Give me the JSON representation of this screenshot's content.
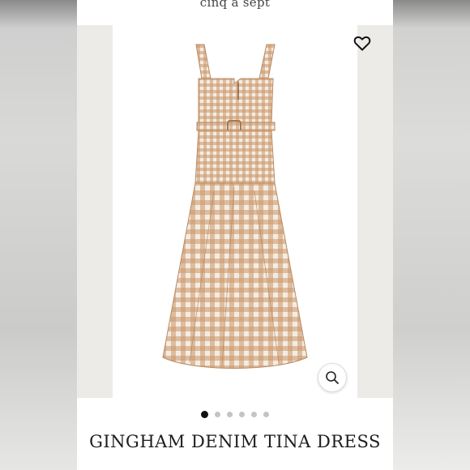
{
  "header": {
    "brand_logo_text": "cinq à sept"
  },
  "gallery": {
    "image_count": 6,
    "active_index": 0,
    "dress_pattern_colors": [
      "#c9966a",
      "#f4ece2"
    ]
  },
  "icons": {
    "favorite": "heart-outline-icon",
    "zoom": "magnify-icon"
  },
  "product": {
    "title": "GINGHAM DENIM TINA DRESS"
  }
}
